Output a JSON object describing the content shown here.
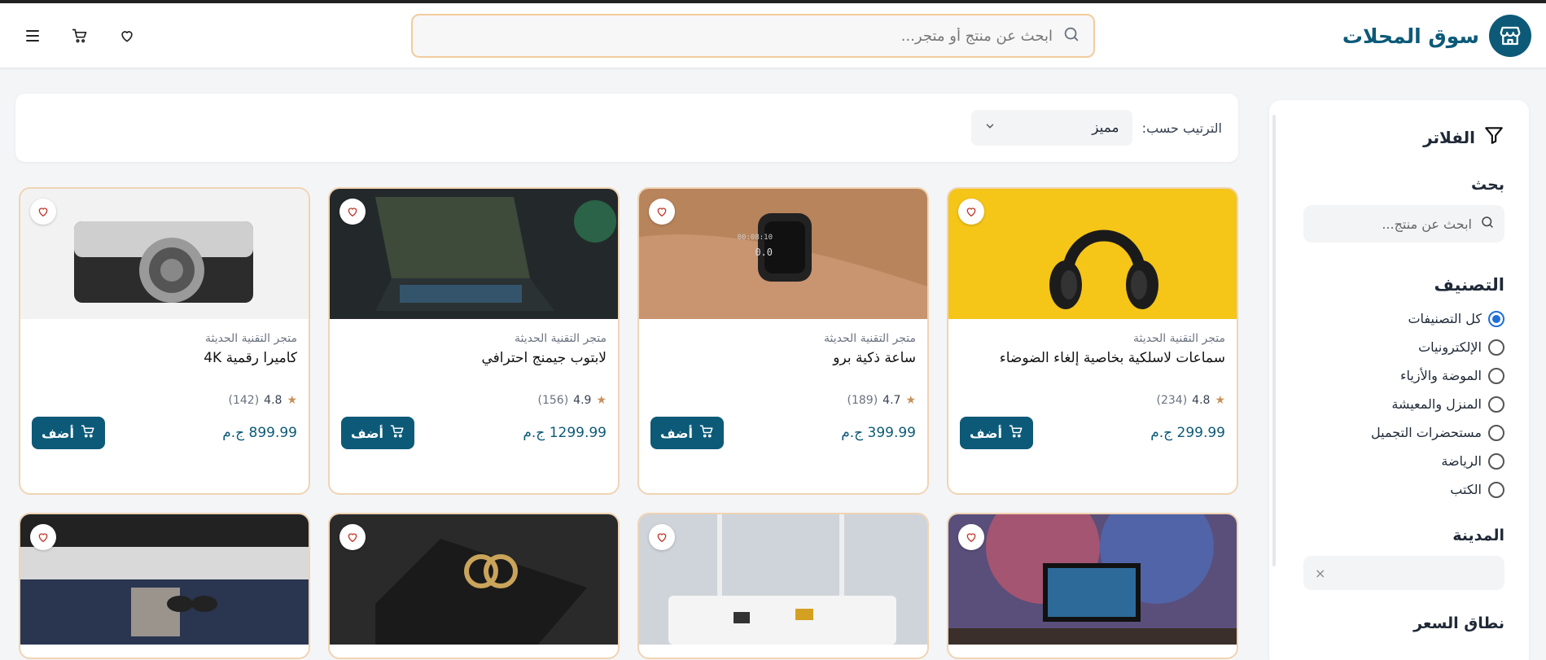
{
  "header": {
    "brand_name": "سوق المحلات",
    "search_placeholder": "ابحث عن منتج أو متجر..."
  },
  "sidebar": {
    "filters_title": "الفلاتر",
    "search_label": "بحث",
    "search_placeholder": "ابحث عن منتج...",
    "category_title": "التصنيف",
    "categories": [
      {
        "label": "كل التصنيفات",
        "selected": true
      },
      {
        "label": "الإلكترونيات",
        "selected": false
      },
      {
        "label": "الموضة والأزياء",
        "selected": false
      },
      {
        "label": "المنزل والمعيشة",
        "selected": false
      },
      {
        "label": "مستحضرات التجميل",
        "selected": false
      },
      {
        "label": "الرياضة",
        "selected": false
      },
      {
        "label": "الكتب",
        "selected": false
      }
    ],
    "city_title": "المدينة",
    "city_clear": "×",
    "price_title": "نطاق السعر"
  },
  "sortbar": {
    "label": "الترتيب حسب:",
    "selected": "مميز"
  },
  "products": [
    {
      "store": "متجر التقنية الحديثة",
      "name": "سماعات لاسلكية بخاصية إلغاء الضوضاء",
      "rating": "4.8",
      "count": "(234)",
      "price": "299.99 ج.م",
      "add_label": "أضف"
    },
    {
      "store": "متجر التقنية الحديثة",
      "name": "ساعة ذكية برو",
      "rating": "4.7",
      "count": "(189)",
      "price": "399.99 ج.م",
      "add_label": "أضف"
    },
    {
      "store": "متجر التقنية الحديثة",
      "name": "لابتوب جيمنج احترافي",
      "rating": "4.9",
      "count": "(156)",
      "price": "1299.99 ج.م",
      "add_label": "أضف"
    },
    {
      "store": "متجر التقنية الحديثة",
      "name": "كاميرا رقمية 4K",
      "rating": "4.8",
      "count": "(142)",
      "price": "899.99 ج.م",
      "add_label": "أضف"
    }
  ],
  "colors": {
    "primary": "#0c5a78",
    "accent_border": "#f0d4b4",
    "star": "#c8915a",
    "radio_selected": "#1e6fd9"
  }
}
